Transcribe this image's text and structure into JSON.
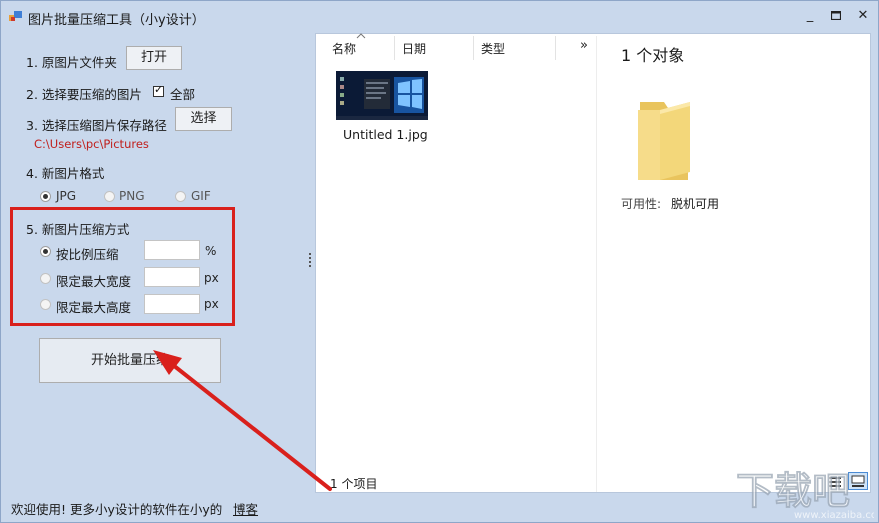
{
  "window": {
    "title": "图片批量压缩工具（小y设计）"
  },
  "controls": {
    "minimize": "_",
    "maximize": "□",
    "close": "✕"
  },
  "step1": {
    "label": "1. 原图片文件夹",
    "button": "打开"
  },
  "step2": {
    "label": "2. 选择要压缩的图片",
    "checkbox_label": "全部",
    "checked": true
  },
  "step3": {
    "label": "3. 选择压缩图片保存路径",
    "button": "选择",
    "path": "C:\\Users\\pc\\Pictures"
  },
  "step4": {
    "label": "4. 新图片格式",
    "options": [
      {
        "label": "JPG",
        "selected": true
      },
      {
        "label": "PNG",
        "selected": false
      },
      {
        "label": "GIF",
        "selected": false
      }
    ]
  },
  "step5": {
    "label": "5. 新图片压缩方式",
    "options": [
      {
        "label": "按比例压缩",
        "selected": true,
        "value": "",
        "unit": "%"
      },
      {
        "label": "限定最大宽度",
        "selected": false,
        "value": "",
        "unit": "px"
      },
      {
        "label": "限定最大高度",
        "selected": false,
        "value": "",
        "unit": "px"
      }
    ]
  },
  "start_button": "开始批量压缩",
  "explorer": {
    "columns": [
      "名称",
      "日期",
      "类型"
    ],
    "more": "»",
    "file_name": "Untitled 1.jpg",
    "details_title": "1 个对象",
    "availability_label": "可用性:",
    "availability_value": "脱机可用",
    "item_count": "1 个项目"
  },
  "statusbar": {
    "message": "欢迎使用! 更多小y设计的软件在小y的",
    "link": "博客"
  },
  "colors": {
    "accent_red": "#d9201c",
    "window_bg": "#c9d8ec",
    "folder_yellow": "#f3d77a"
  }
}
